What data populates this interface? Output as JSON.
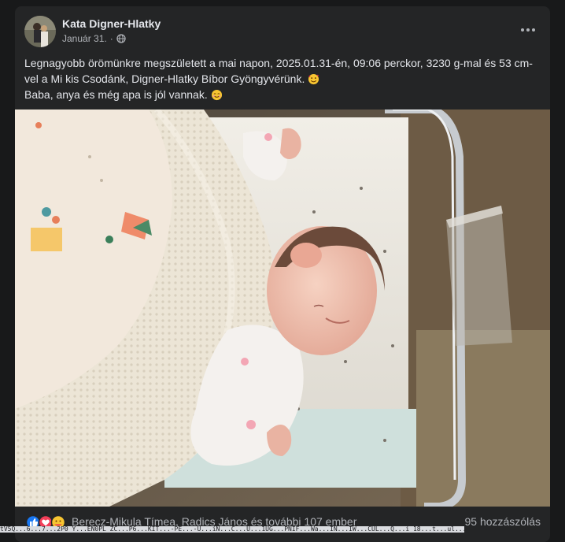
{
  "post": {
    "author": "Kata Digner-Hlatky",
    "date": "Január 31.",
    "separator": "·",
    "audience_icon": "globe-icon",
    "text_line1_a": "Legnagyobb örömünkre megszületett a mai napon,  2025.01.31-én, 09:06 perckor, 3230 g-mal és 53 cm-vel a Mi kis Csodánk, Digner-Hlatky Bíbor Gyöngyvérünk.",
    "text_line1_emoji": "smiling-face-with-hearts-emoji",
    "text_line2": "Baba, anya és még apa is jól vannak.",
    "text_line2_emoji": "smiling-face-emoji"
  },
  "photo": {
    "subject": "newborn-baby-photo"
  },
  "reactions": {
    "icons": [
      "like-icon",
      "love-icon",
      "care-icon"
    ],
    "names": "Berecz-Mikula Tímea, Radics János és további 107 ember",
    "comments": "95 hozzászólás"
  },
  "status_url": "tV5Q...6...7...2P0 Y...EN0PL ZC...P6...KIT...-PE...-U...iN...C...U...1UG...PNIF...Wa...IN...IW...CUL...Q...i 18...t...ul...E0...P"
}
